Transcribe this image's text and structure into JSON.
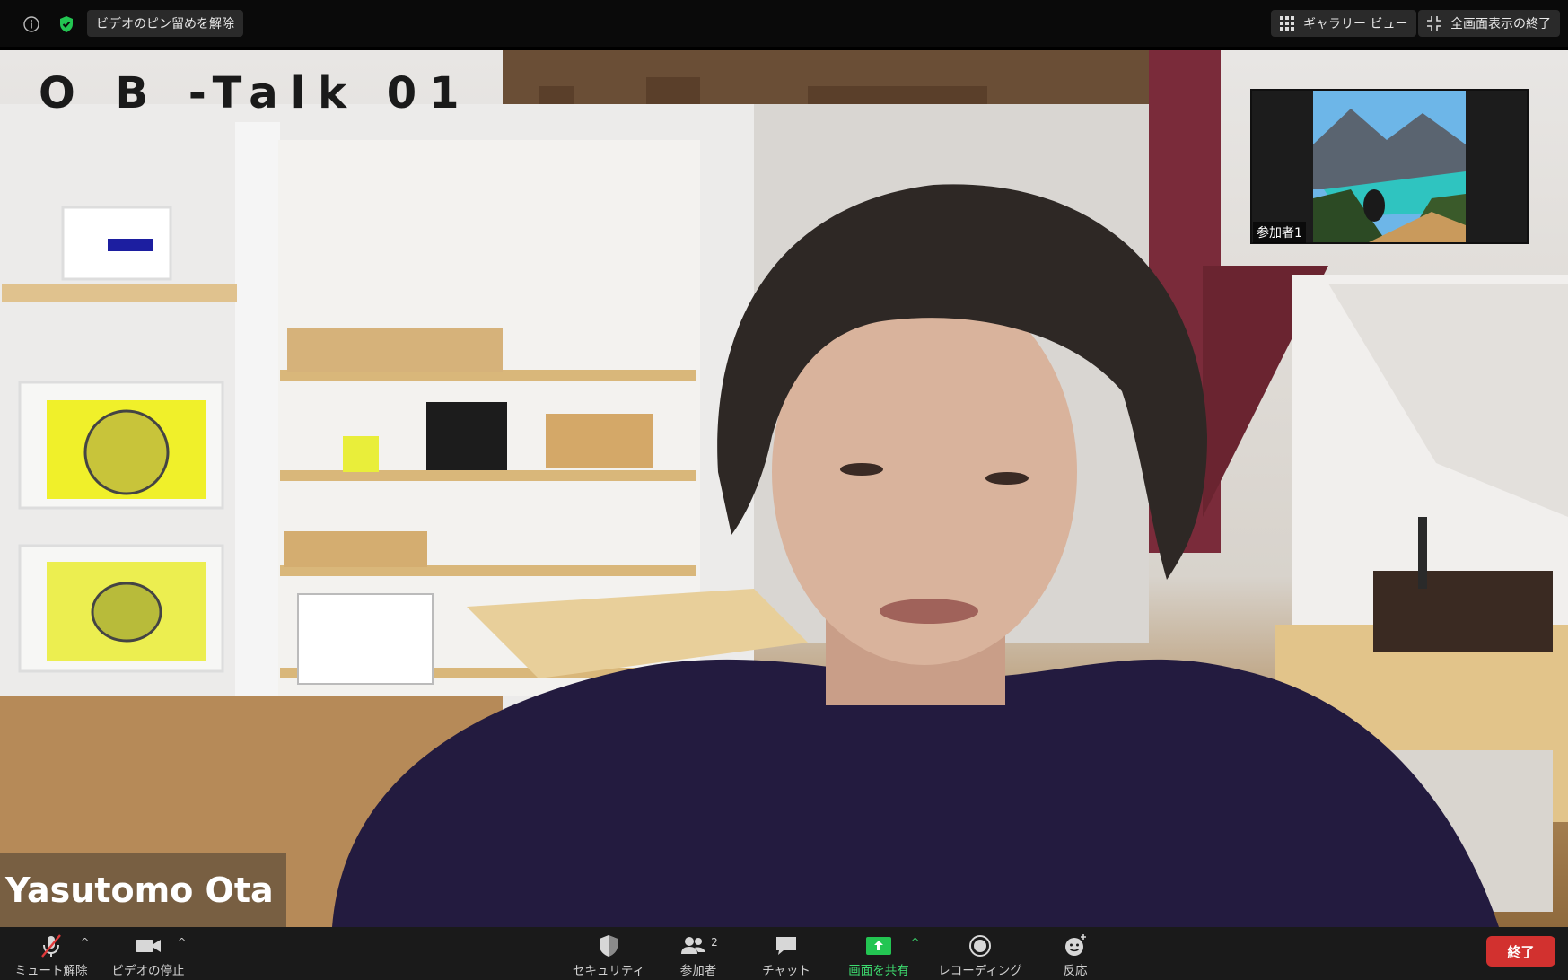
{
  "top_bar": {
    "unpin_label": "ビデオのピン留めを解除",
    "gallery_label": "ギャラリー ビュー",
    "exit_fullscreen_label": "全画面表示の終了"
  },
  "main_video": {
    "overlay_title": "O B -Talk 01",
    "speaker_name": "Yasutomo Ota"
  },
  "thumbnail": {
    "participant_label": "参加者1"
  },
  "toolbar": {
    "unmute_label": "ミュート解除",
    "stop_video_label": "ビデオの停止",
    "security_label": "セキュリティ",
    "participants_label": "参加者",
    "participants_count": "2",
    "chat_label": "チャット",
    "share_label": "画面を共有",
    "record_label": "レコーディング",
    "reactions_label": "反応",
    "end_label": "終了",
    "share_color": "#23c552",
    "end_color": "#d2312f"
  }
}
